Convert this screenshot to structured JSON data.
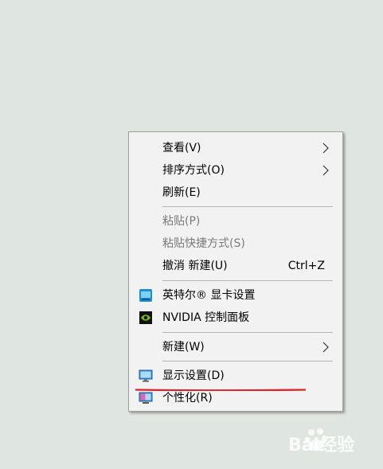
{
  "context_menu": {
    "items": [
      {
        "label": "查看(V)",
        "has_submenu": true
      },
      {
        "label": "排序方式(O)",
        "has_submenu": true
      },
      {
        "label": "刷新(E)"
      },
      {
        "label": "粘贴(P)",
        "disabled": true
      },
      {
        "label": "粘贴快捷方式(S)",
        "disabled": true
      },
      {
        "label": "撤消 新建(U)",
        "shortcut": "Ctrl+Z"
      },
      {
        "label": "英特尔® 显卡设置",
        "icon": "intel-graphics-icon"
      },
      {
        "label": "NVIDIA 控制面板",
        "icon": "nvidia-icon"
      },
      {
        "label": "新建(W)",
        "has_submenu": true
      },
      {
        "label": "显示设置(D)",
        "icon": "display-settings-icon"
      },
      {
        "label": "个性化(R)",
        "icon": "personalize-icon"
      }
    ]
  },
  "annotation": {
    "color": "#e0202a"
  },
  "watermark": {
    "text": "Bai经验"
  },
  "colors": {
    "desktop": "#dfe6e1",
    "menu_bg": "#f2f2f2",
    "disabled_text": "#7a7a7a"
  }
}
